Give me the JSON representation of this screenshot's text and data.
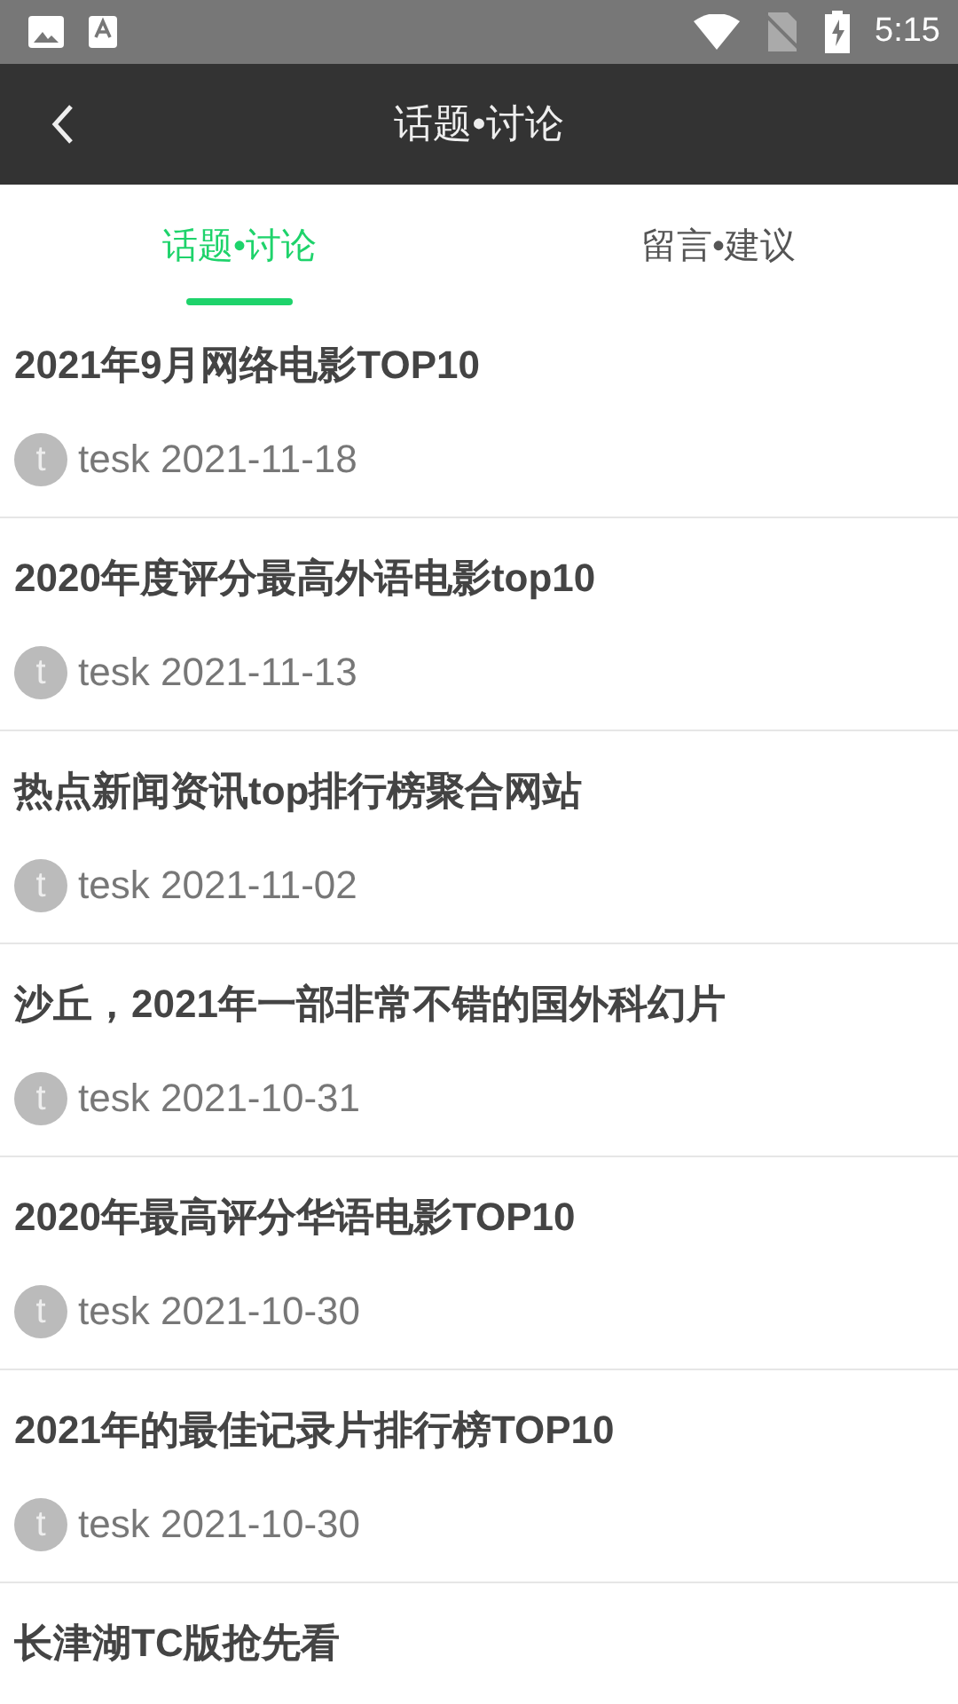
{
  "status_bar": {
    "time": "5:15"
  },
  "header": {
    "title": "话题•讨论"
  },
  "tabs": [
    {
      "label": "话题•讨论",
      "selected": true
    },
    {
      "label": "留言•建议",
      "selected": false
    }
  ],
  "posts": [
    {
      "title": "2021年9月网络电影TOP10",
      "avatar_letter": "t",
      "author": "tesk",
      "date": "2021-11-18"
    },
    {
      "title": "2020年度评分最高外语电影top10",
      "avatar_letter": "t",
      "author": "tesk",
      "date": "2021-11-13"
    },
    {
      "title": "热点新闻资讯top排行榜聚合网站",
      "avatar_letter": "t",
      "author": "tesk",
      "date": "2021-11-02"
    },
    {
      "title": "沙丘，2021年一部非常不错的国外科幻片",
      "avatar_letter": "t",
      "author": "tesk",
      "date": "2021-10-31"
    },
    {
      "title": "2020年最高评分华语电影TOP10",
      "avatar_letter": "t",
      "author": "tesk",
      "date": "2021-10-30"
    },
    {
      "title": "2021年的最佳记录片排行榜TOP10",
      "avatar_letter": "t",
      "author": "tesk",
      "date": "2021-10-30"
    },
    {
      "title": "长津湖TC版抢先看"
    }
  ]
}
